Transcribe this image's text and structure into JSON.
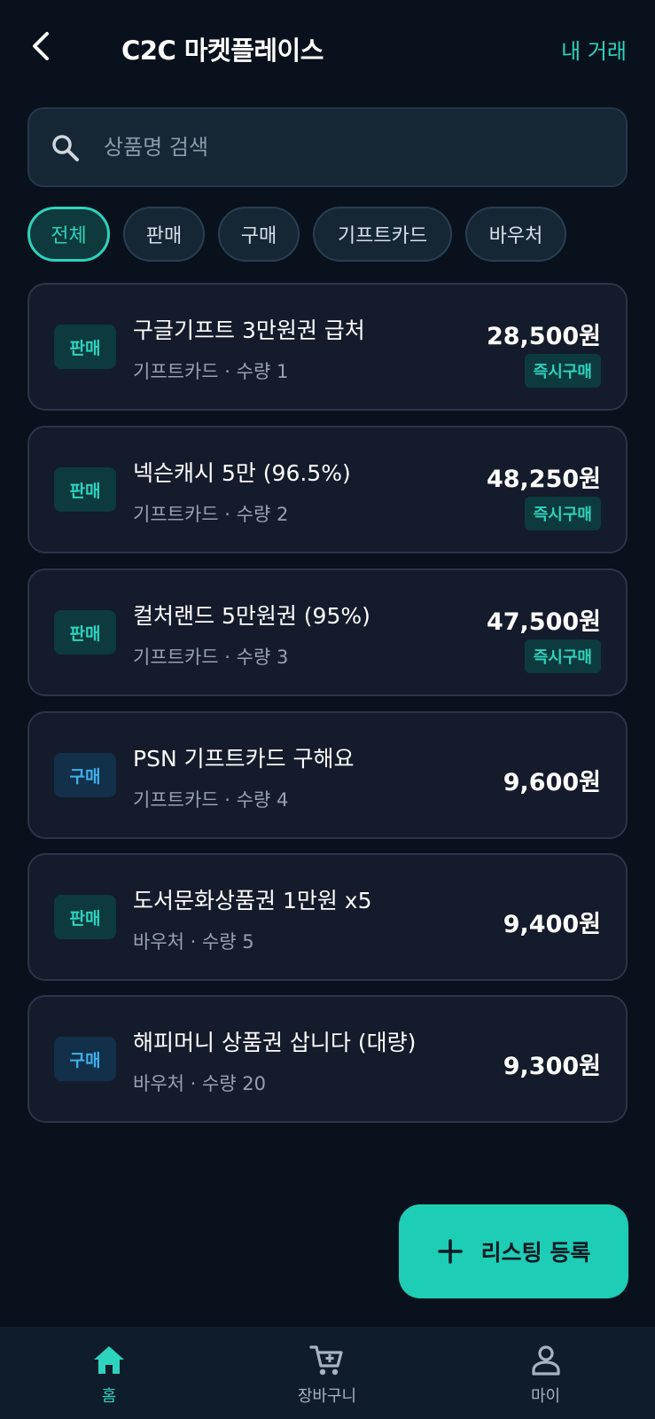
{
  "header": {
    "title": "C2C 마켓플레이스",
    "my_trades": "내 거래"
  },
  "search": {
    "placeholder": "상품명 검색",
    "value": ""
  },
  "filters": [
    "전체",
    "판매",
    "구매",
    "기프트카드",
    "바우처"
  ],
  "active_filter": "전체",
  "listings": [
    {
      "type": "판매",
      "kind": "sell",
      "title": "구글기프트 3만원권 급처",
      "meta": "기프트카드 · 수량 1",
      "price": "28,500원",
      "instant": "즉시구매"
    },
    {
      "type": "판매",
      "kind": "sell",
      "title": "넥슨캐시 5만 (96.5%)",
      "meta": "기프트카드 · 수량 2",
      "price": "48,250원",
      "instant": "즉시구매"
    },
    {
      "type": "판매",
      "kind": "sell",
      "title": "컬처랜드 5만원권 (95%)",
      "meta": "기프트카드 · 수량 3",
      "price": "47,500원",
      "instant": "즉시구매"
    },
    {
      "type": "구매",
      "kind": "buy",
      "title": "PSN 기프트카드 구해요",
      "meta": "기프트카드 · 수량 4",
      "price": "9,600원",
      "instant": ""
    },
    {
      "type": "판매",
      "kind": "sell",
      "title": "도서문화상품권 1만원 x5",
      "meta": "바우처 · 수량 5",
      "price": "9,400원",
      "instant": ""
    },
    {
      "type": "구매",
      "kind": "buy",
      "title": "해피머니 상품권 삽니다 (대량)",
      "meta": "바우처 · 수량 20",
      "price": "9,300원",
      "instant": ""
    }
  ],
  "fab": {
    "label": "리스팅 등록",
    "icon": "plus-icon"
  },
  "nav": [
    {
      "label": "홈",
      "icon": "home-icon"
    },
    {
      "label": "장바구니",
      "icon": "cart-icon"
    },
    {
      "label": "마이",
      "icon": "person-icon"
    }
  ],
  "colors": {
    "background": "#08111c",
    "accent": "#2ed3bd",
    "buy_accent": "#3fb0ec",
    "card": "#141b2b"
  }
}
